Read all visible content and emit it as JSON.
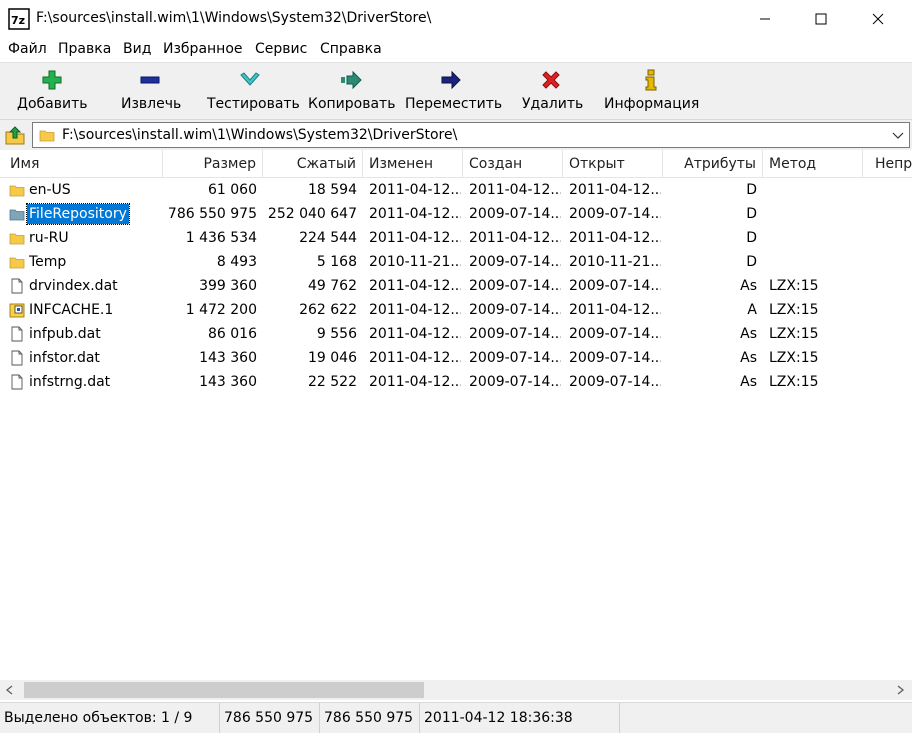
{
  "window": {
    "title": "F:\\sources\\install.wim\\1\\Windows\\System32\\DriverStore\\",
    "app_icon": "7z-icon"
  },
  "menu": [
    "Файл",
    "Правка",
    "Вид",
    "Избранное",
    "Сервис",
    "Справка"
  ],
  "toolbar": [
    {
      "label": "Добавить",
      "icon": "plus-icon",
      "color": "#22b14c"
    },
    {
      "label": "Извлечь",
      "icon": "minus-icon",
      "color": "#1f2f9e"
    },
    {
      "label": "Тестировать",
      "icon": "check-icon",
      "color": "#3fc4c8"
    },
    {
      "label": "Копировать",
      "icon": "copy-arrow-icon",
      "color": "#2a8a74"
    },
    {
      "label": "Переместить",
      "icon": "move-arrow-icon",
      "color": "#1a237e"
    },
    {
      "label": "Удалить",
      "icon": "delete-x-icon",
      "color": "#e02020"
    },
    {
      "label": "Информация",
      "icon": "info-icon",
      "color": "#e6b800"
    }
  ],
  "address": {
    "path": "F:\\sources\\install.wim\\1\\Windows\\System32\\DriverStore\\"
  },
  "columns": [
    "Имя",
    "Размер",
    "Сжатый",
    "Изменен",
    "Создан",
    "Открыт",
    "Атрибуты",
    "Метод",
    "Непр"
  ],
  "rows": [
    {
      "name": "en-US",
      "type": "folder",
      "size": "61 060",
      "packed": "18 594",
      "modified": "2011-04-12...",
      "created": "2011-04-12...",
      "accessed": "2011-04-12...",
      "attributes": "D",
      "method": ""
    },
    {
      "name": "FileRepository",
      "type": "folder-selected",
      "size": "786 550 975",
      "packed": "252 040 647",
      "modified": "2011-04-12...",
      "created": "2009-07-14...",
      "accessed": "2009-07-14...",
      "attributes": "D",
      "method": ""
    },
    {
      "name": "ru-RU",
      "type": "folder",
      "size": "1 436 534",
      "packed": "224 544",
      "modified": "2011-04-12...",
      "created": "2011-04-12...",
      "accessed": "2011-04-12...",
      "attributes": "D",
      "method": ""
    },
    {
      "name": "Temp",
      "type": "folder",
      "size": "8 493",
      "packed": "5 168",
      "modified": "2010-11-21...",
      "created": "2009-07-14...",
      "accessed": "2010-11-21...",
      "attributes": "D",
      "method": ""
    },
    {
      "name": "drvindex.dat",
      "type": "file",
      "size": "399 360",
      "packed": "49 762",
      "modified": "2011-04-12...",
      "created": "2009-07-14...",
      "accessed": "2009-07-14...",
      "attributes": "As",
      "method": "LZX:15"
    },
    {
      "name": "INFCACHE.1",
      "type": "file-special",
      "size": "1 472 200",
      "packed": "262 622",
      "modified": "2011-04-12...",
      "created": "2009-07-14...",
      "accessed": "2011-04-12...",
      "attributes": "A",
      "method": "LZX:15"
    },
    {
      "name": "infpub.dat",
      "type": "file",
      "size": "86 016",
      "packed": "9 556",
      "modified": "2011-04-12...",
      "created": "2009-07-14...",
      "accessed": "2009-07-14...",
      "attributes": "As",
      "method": "LZX:15"
    },
    {
      "name": "infstor.dat",
      "type": "file",
      "size": "143 360",
      "packed": "19 046",
      "modified": "2011-04-12...",
      "created": "2009-07-14...",
      "accessed": "2009-07-14...",
      "attributes": "As",
      "method": "LZX:15"
    },
    {
      "name": "infstrng.dat",
      "type": "file",
      "size": "143 360",
      "packed": "22 522",
      "modified": "2011-04-12...",
      "created": "2009-07-14...",
      "accessed": "2009-07-14...",
      "attributes": "As",
      "method": "LZX:15"
    }
  ],
  "selected_row": 1,
  "status": {
    "selection": "Выделено объектов: 1 / 9",
    "size": "786 550 975",
    "packed": "786 550 975",
    "date": "2011-04-12 18:36:38"
  },
  "colors": {
    "selection": "#0078d7",
    "folder": "#f7c948",
    "bar_background": "#f0f0f0"
  }
}
